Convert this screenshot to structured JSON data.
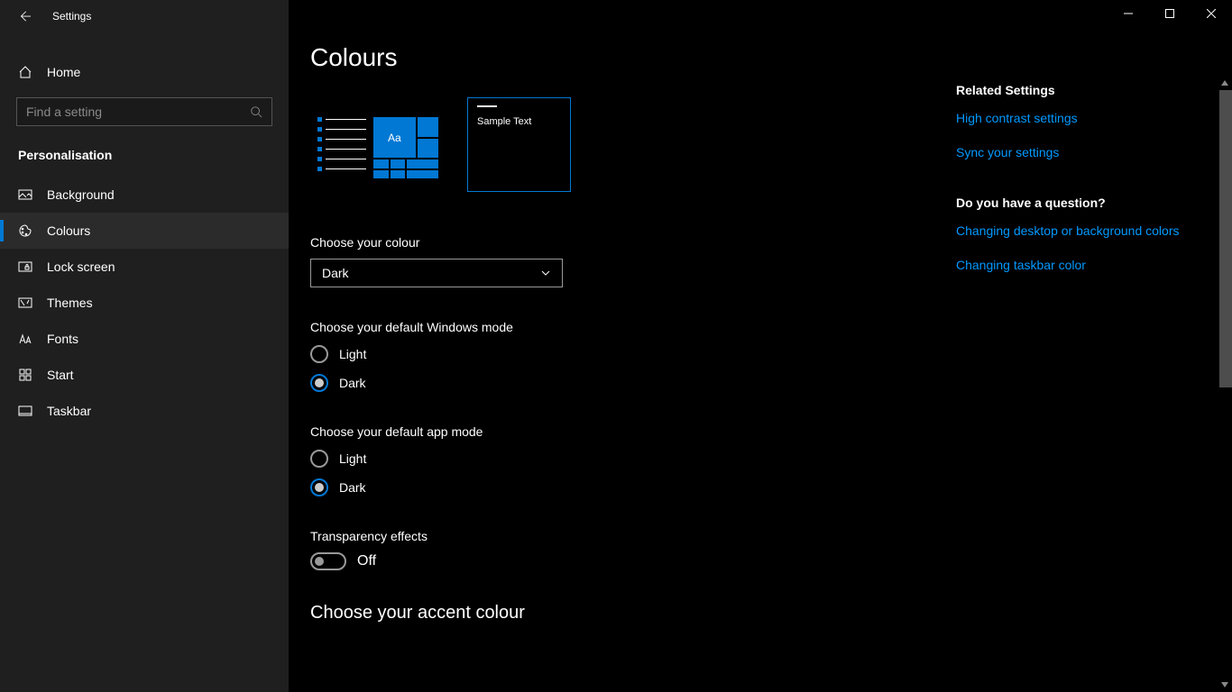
{
  "app_title": "Settings",
  "home_label": "Home",
  "search_placeholder": "Find a setting",
  "category_label": "Personalisation",
  "nav": [
    {
      "label": "Background"
    },
    {
      "label": "Colours"
    },
    {
      "label": "Lock screen"
    },
    {
      "label": "Themes"
    },
    {
      "label": "Fonts"
    },
    {
      "label": "Start"
    },
    {
      "label": "Taskbar"
    }
  ],
  "page_title": "Colours",
  "preview": {
    "aa": "Aa",
    "sample": "Sample Text"
  },
  "choose_colour_label": "Choose your colour",
  "choose_colour_value": "Dark",
  "windows_mode_label": "Choose your default Windows mode",
  "windows_mode_options": {
    "light": "Light",
    "dark": "Dark"
  },
  "app_mode_label": "Choose your default app mode",
  "app_mode_options": {
    "light": "Light",
    "dark": "Dark"
  },
  "transparency_label": "Transparency effects",
  "transparency_state": "Off",
  "accent_heading": "Choose your accent colour",
  "related": {
    "heading": "Related Settings",
    "links": [
      "High contrast settings",
      "Sync your settings"
    ]
  },
  "question": {
    "heading": "Do you have a question?",
    "links": [
      "Changing desktop or background colors",
      "Changing taskbar color"
    ]
  },
  "accent_color": "#0078d4"
}
